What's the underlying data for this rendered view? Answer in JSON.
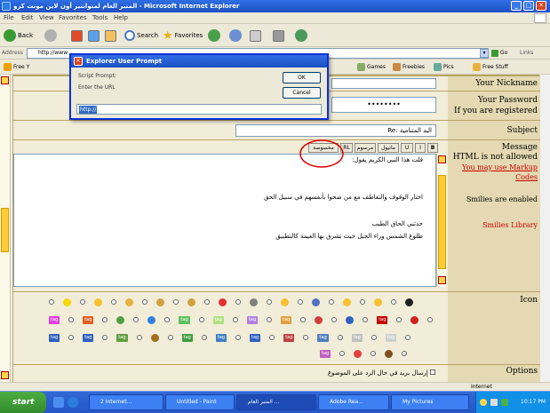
{
  "window": {
    "title": "المنبر العام لمنوانتير أون لاين مونت كرو - Microsoft Internet Explorer",
    "min_glyph": "_",
    "max_glyph": "□",
    "close_glyph": "✕"
  },
  "menu": [
    "File",
    "Edit",
    "View",
    "Favorites",
    "Tools",
    "Help"
  ],
  "toolbar": {
    "back_label": "Back",
    "search_label": "Search",
    "favorites_label": "Favorites"
  },
  "address": {
    "label": "Address",
    "url": "http://www",
    "go_label": "Go",
    "links_label": "Links"
  },
  "links_bar": {
    "left_item": "Free Y",
    "items": [
      "Games",
      "Freebies",
      "Pics",
      "Free Stuff"
    ]
  },
  "dialog": {
    "title": "Explorer User Prompt",
    "script_prompt": "Script Prompt:",
    "instruction": "Enter the URL",
    "ok_label": "OK",
    "cancel_label": "Cancel",
    "input_value": "http://"
  },
  "form": {
    "nickname_label": "Your Nickname",
    "password_label": "Your Password",
    "password_note": "If you are registered",
    "subject_label": "Subject",
    "subject_value": "Re: اليد المتنامية",
    "message_label": "Message",
    "html_note": "HTML is not allowed",
    "markup_note": "You may use Markup Codes",
    "smilies_note": "Smilies are enabled",
    "smilies_library": "Smilies Library",
    "icon_label": "Icon",
    "options_label": "Options",
    "options_text": "إرسال بريد في حال الرد على الموضوع",
    "password_value": "••••••••",
    "format_buttons": [
      "B",
      "I",
      "U",
      "ماتيول",
      "مرسوم",
      "RL",
      "مخصوصة"
    ],
    "message_lines": [
      "قلت هذا النبي الكريم يقول:",
      "اختار الوقوف والتعاطف مع من ضحوا بأنفسهم في سبيل الحق",
      "",
      "حدثني الحاق الطيب",
      "طلوع الشمس وراء الجبل حيث تشرق بها الغيمة كالتطبيق"
    ]
  },
  "taskbar": {
    "start_label": "start",
    "tasks": [
      "2 Internet...",
      "Untitled - Paint",
      "المنبر العام ...",
      "Adobe Rea...",
      "My Pictures"
    ],
    "clock": "10:17 PM"
  },
  "status": {
    "zone": "Internet"
  }
}
